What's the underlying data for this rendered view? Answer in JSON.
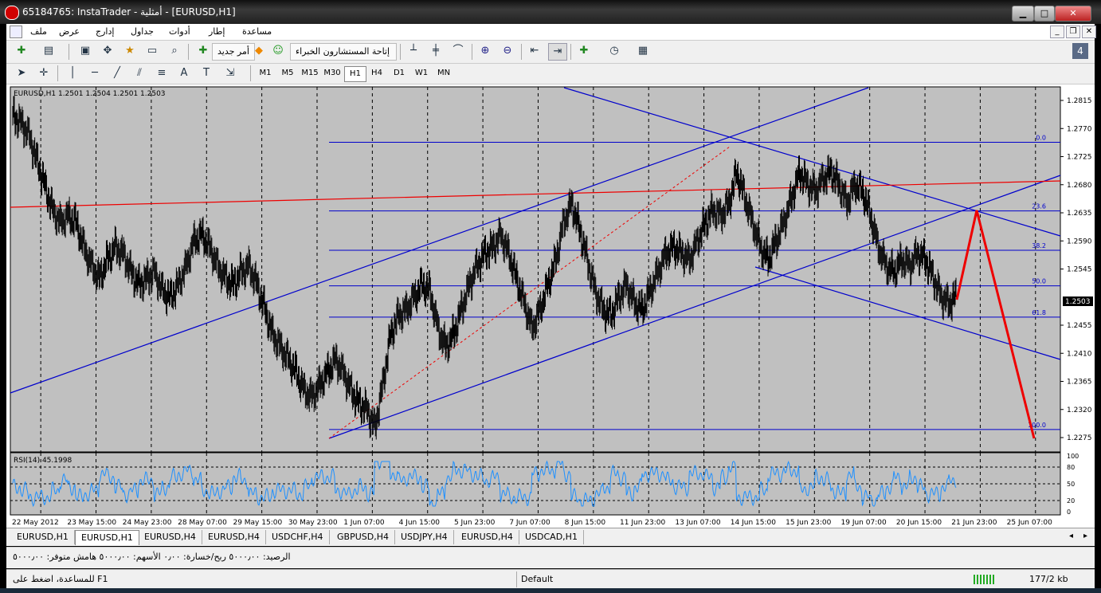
{
  "window": {
    "title": "65184765: InstaTrader - أمثلية - [EURUSD,H1]",
    "min_label": "▁",
    "max_label": "□",
    "close_label": "✕"
  },
  "menu": {
    "items": [
      "ملف",
      "عرض",
      "إدارج",
      "جداول",
      "أدوات",
      "إطار",
      "مساعدة"
    ]
  },
  "toolbar": {
    "new_order_label": "أمر جديد",
    "experts_label": "إتاحة المستشارون الخبراء"
  },
  "timeframes": [
    "M1",
    "M5",
    "M15",
    "M30",
    "H1",
    "H4",
    "D1",
    "W1",
    "MN"
  ],
  "active_timeframe": "H1",
  "chart": {
    "header": "EURUSD,H1  1.2501 1.2504 1.2501 1.2503",
    "current_price": "1.2503",
    "rsi_label": "RSI(14) 45.1998"
  },
  "chart_data": {
    "type": "candlestick",
    "symbol": "EURUSD",
    "timeframe": "H1",
    "ohlc_last": {
      "open": 1.2501,
      "high": 1.2504,
      "low": 1.2501,
      "close": 1.2503
    },
    "y_ticks": [
      "1.2815",
      "1.2770",
      "1.2725",
      "1.2680",
      "1.2635",
      "1.2590",
      "1.2545",
      "1.2455",
      "1.2410",
      "1.2365",
      "1.2320",
      "1.2275"
    ],
    "ylim": [
      1.2275,
      1.2815
    ],
    "x_ticks": [
      "22 May 2012",
      "23 May 15:00",
      "24 May 23:00",
      "28 May 07:00",
      "29 May 15:00",
      "30 May 23:00",
      "1 Jun 07:00",
      "4 Jun 15:00",
      "5 Jun 23:00",
      "7 Jun 07:00",
      "8 Jun 15:00",
      "11 Jun 23:00",
      "13 Jun 07:00",
      "14 Jun 15:00",
      "15 Jun 23:00",
      "19 Jun 07:00",
      "20 Jun 15:00",
      "21 Jun 23:00",
      "25 Jun 07:00"
    ],
    "fibonacci_levels": [
      {
        "label": "0.0",
        "price": 1.2748
      },
      {
        "label": "23.6",
        "price": 1.2638
      },
      {
        "label": "38.2",
        "price": 1.2575
      },
      {
        "label": "50.0",
        "price": 1.2518
      },
      {
        "label": "61.8",
        "price": 1.2468
      },
      {
        "label": "100.0",
        "price": 1.2288
      }
    ],
    "rsi": {
      "period": 14,
      "value": 45.1998,
      "levels": [
        "100",
        "80",
        "50",
        "20",
        "0"
      ]
    },
    "close_series": [
      1.279,
      1.278,
      1.276,
      1.272,
      1.268,
      1.264,
      1.262,
      1.263,
      1.262,
      1.258,
      1.255,
      1.253,
      1.256,
      1.258,
      1.257,
      1.254,
      1.252,
      1.253,
      1.254,
      1.251,
      1.25,
      1.252,
      1.255,
      1.259,
      1.26,
      1.258,
      1.255,
      1.253,
      1.252,
      1.254,
      1.255,
      1.252,
      1.248,
      1.244,
      1.242,
      1.24,
      1.238,
      1.235,
      1.234,
      1.236,
      1.238,
      1.24,
      1.238,
      1.235,
      1.233,
      1.232,
      1.229,
      1.236,
      1.244,
      1.247,
      1.248,
      1.25,
      1.252,
      1.251,
      1.245,
      1.242,
      1.244,
      1.248,
      1.252,
      1.255,
      1.257,
      1.258,
      1.26,
      1.257,
      1.253,
      1.249,
      1.245,
      1.248,
      1.252,
      1.256,
      1.262,
      1.265,
      1.261,
      1.256,
      1.251,
      1.248,
      1.247,
      1.25,
      1.252,
      1.249,
      1.248,
      1.251,
      1.254,
      1.257,
      1.258,
      1.257,
      1.256,
      1.259,
      1.262,
      1.264,
      1.263,
      1.265,
      1.27,
      1.266,
      1.262,
      1.258,
      1.256,
      1.259,
      1.262,
      1.266,
      1.27,
      1.268,
      1.267,
      1.269,
      1.27,
      1.268,
      1.265,
      1.268,
      1.267,
      1.263,
      1.258,
      1.255,
      1.254,
      1.256,
      1.255,
      1.257,
      1.256,
      1.253,
      1.25,
      1.249,
      1.2503
    ]
  },
  "tabs": [
    "EURUSD,H1",
    "EURUSD,H1",
    "EURUSD,H4",
    "EURUSD,H4",
    "USDCHF,H4",
    "GBPUSD,H4",
    "USDJPY,H4",
    "EURUSD,H4",
    "USDCAD,H1"
  ],
  "active_tab_index": 1,
  "account": {
    "balance_text": "الرصيد: ٥٠٠٠٫٠٠  ربح/خسارة: ٠٫٠٠  الأسهم: ٥٠٠٠٫٠٠  هامش متوفر: ٥٠٠٠٫٠٠"
  },
  "status": {
    "help_text": "للمساعدة، اضغط على F1",
    "profile": "Default",
    "traffic": "177/2 kb"
  },
  "colors": {
    "chart_bg": "#c0c0c0",
    "channel_line": "#0000cc",
    "red_line": "#ee0000",
    "candles": "#000000"
  }
}
